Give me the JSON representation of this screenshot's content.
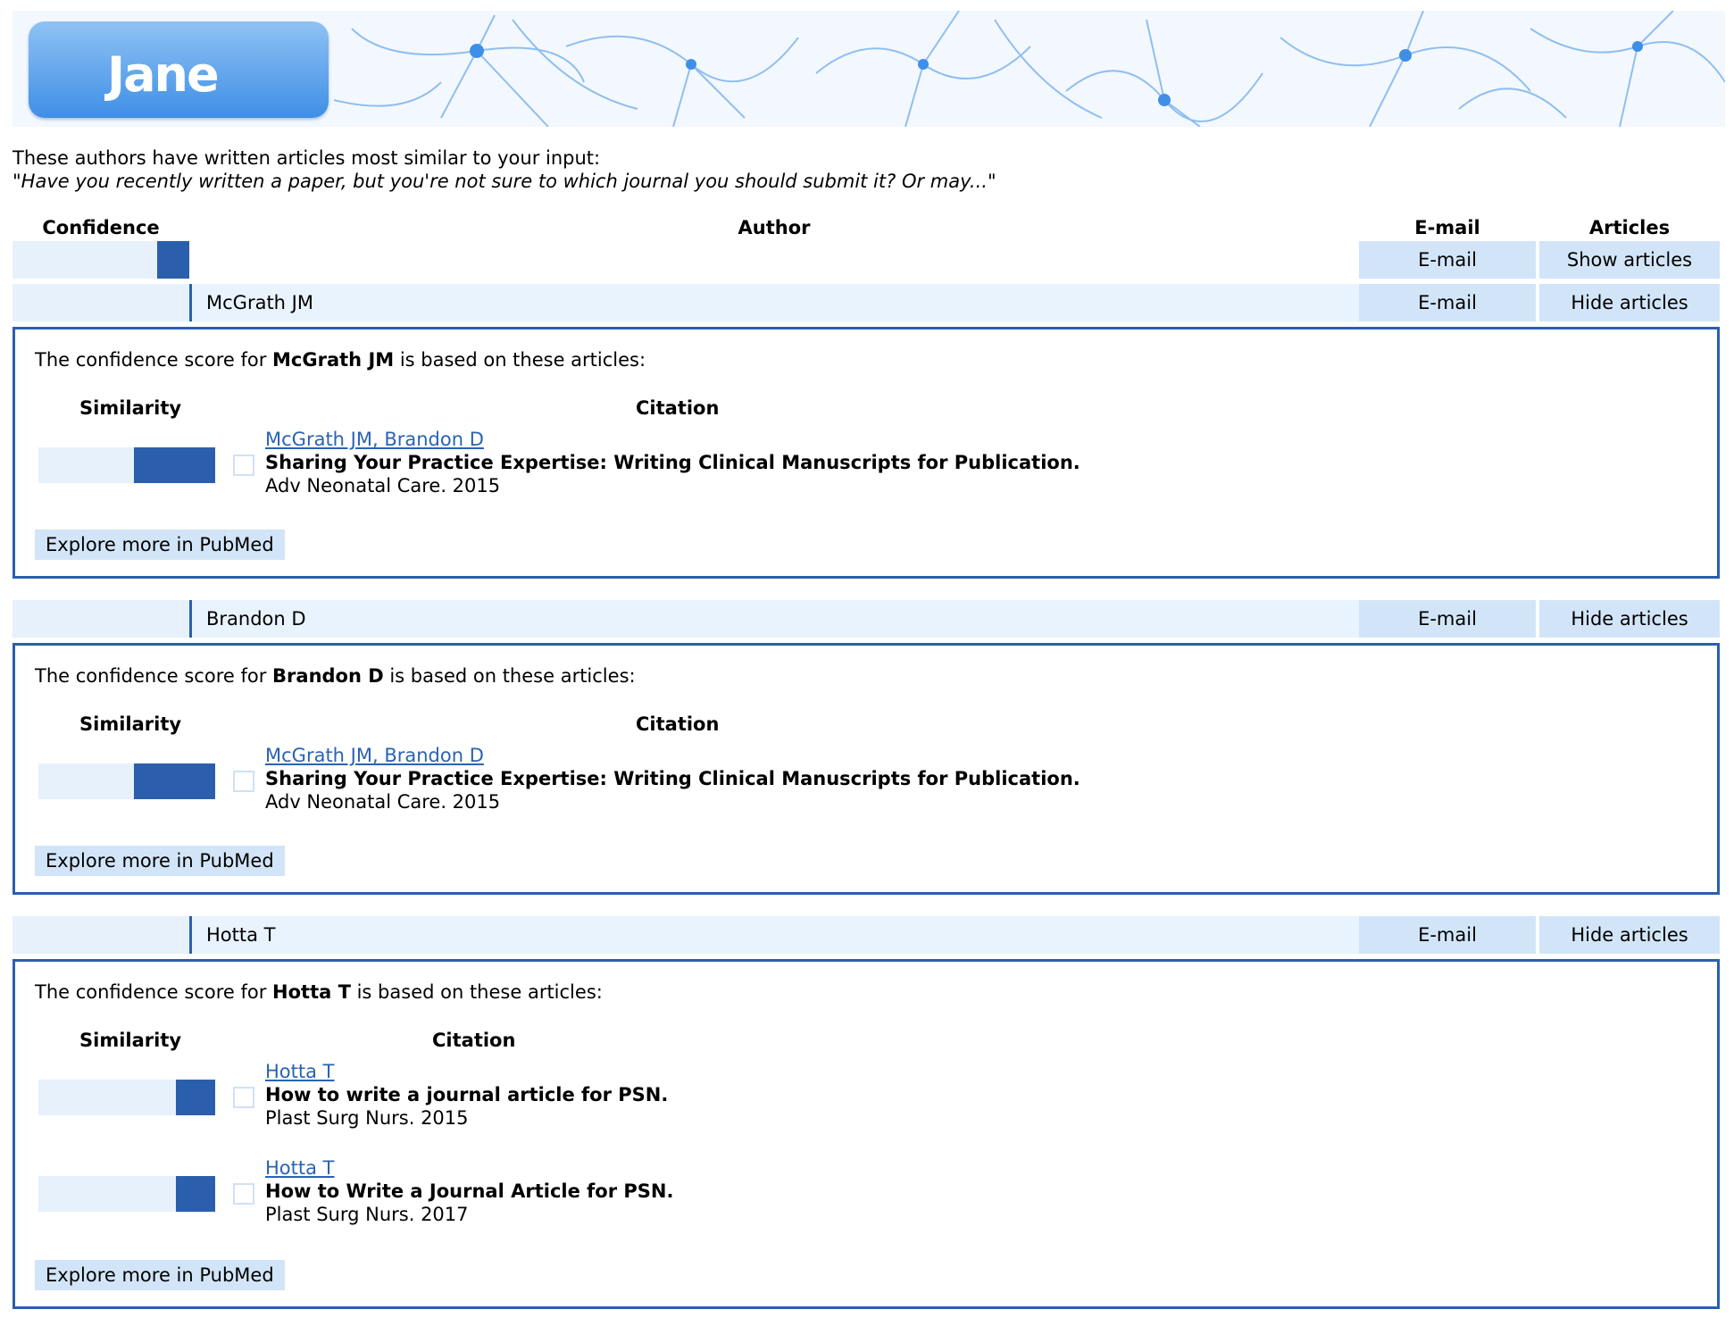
{
  "logo": {
    "text": "Jane"
  },
  "intro": {
    "line1": "These authors have written articles most similar to your input:",
    "quote": "\"Have you recently written a paper, but you're not sure to which journal you should submit it? Or may...\""
  },
  "table_headers": {
    "confidence": "Confidence",
    "author": "Author",
    "email": "E-mail",
    "articles": "Articles"
  },
  "rows": [
    {
      "author": "",
      "confidence": 0.18,
      "email_label": "E-mail",
      "articles_label": "Show articles"
    },
    {
      "author": "McGrath JM",
      "confidence": 0.0,
      "email_label": "E-mail",
      "articles_label": "Hide articles"
    },
    {
      "author": "Brandon D",
      "confidence": 0.0,
      "email_label": "E-mail",
      "articles_label": "Hide articles"
    },
    {
      "author": "Hotta T",
      "confidence": 0.0,
      "email_label": "E-mail",
      "articles_label": "Hide articles"
    }
  ],
  "panels": [
    {
      "prefix": "The confidence score for ",
      "author": "McGrath JM",
      "suffix": " is based on these articles:",
      "similarity_header": "Similarity",
      "citation_header": "Citation",
      "articles": [
        {
          "authors": "McGrath JM, Brandon D",
          "title": "Sharing Your Practice Expertise: Writing Clinical Manuscripts for Publication.",
          "journal": "Adv Neonatal Care. 2015",
          "similarity": 0.46
        }
      ],
      "pubmed_label": "Explore more in PubMed"
    },
    {
      "prefix": "The confidence score for ",
      "author": "Brandon D",
      "suffix": " is based on these articles:",
      "similarity_header": "Similarity",
      "citation_header": "Citation",
      "articles": [
        {
          "authors": "McGrath JM, Brandon D",
          "title": "Sharing Your Practice Expertise: Writing Clinical Manuscripts for Publication.",
          "journal": "Adv Neonatal Care. 2015",
          "similarity": 0.46
        }
      ],
      "pubmed_label": "Explore more in PubMed"
    },
    {
      "prefix": "The confidence score for ",
      "author": "Hotta T",
      "suffix": " is based on these articles:",
      "similarity_header": "Similarity",
      "citation_header": "Citation",
      "articles": [
        {
          "authors": "Hotta T",
          "title": "How to write a journal article for PSN.",
          "journal": "Plast Surg Nurs. 2015",
          "similarity": 0.22
        },
        {
          "authors": "Hotta T",
          "title": "How to Write a Journal Article for PSN.",
          "journal": "Plast Surg Nurs. 2017",
          "similarity": 0.22
        }
      ],
      "pubmed_label": "Explore more in PubMed"
    }
  ],
  "colors": {
    "accent": "#2b5fad",
    "row_bg": "#e9f3fd",
    "button_bg": "#d2e5f8",
    "link": "#2a63b3"
  }
}
